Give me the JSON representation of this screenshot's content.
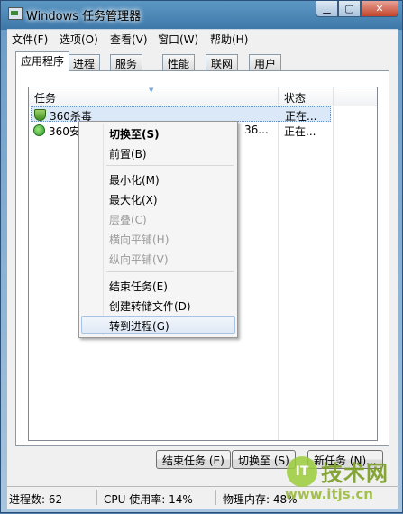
{
  "window": {
    "title": "Windows 任务管理器"
  },
  "menu": [
    "文件(F)",
    "选项(O)",
    "查看(V)",
    "窗口(W)",
    "帮助(H)"
  ],
  "tabs": [
    "应用程序",
    "进程",
    "服务",
    "性能",
    "联网",
    "用户"
  ],
  "list": {
    "headers": {
      "task": "任务",
      "status": "状态"
    },
    "rows": [
      {
        "name": "360杀毒",
        "extra": "",
        "status": "正在..."
      },
      {
        "name": "360安",
        "extra": "36...",
        "status": "正在..."
      }
    ]
  },
  "context_menu": [
    "切换至(S)",
    "前置(B)",
    "最小化(M)",
    "最大化(X)",
    "层叠(C)",
    "横向平铺(H)",
    "纵向平铺(V)",
    "结束任务(E)",
    "创建转储文件(D)",
    "转到进程(G)"
  ],
  "buttons": {
    "end_task": "结束任务 (E)",
    "switch_to": "切换至 (S)",
    "new_task": "新任务 (N)..."
  },
  "status_bar": {
    "processes": "进程数: 62",
    "cpu": "CPU 使用率: 14%",
    "memory": "物理内存: 48%"
  },
  "watermark": {
    "badge": "IT",
    "brand": "技术网",
    "url": "www.itjs.cn"
  }
}
